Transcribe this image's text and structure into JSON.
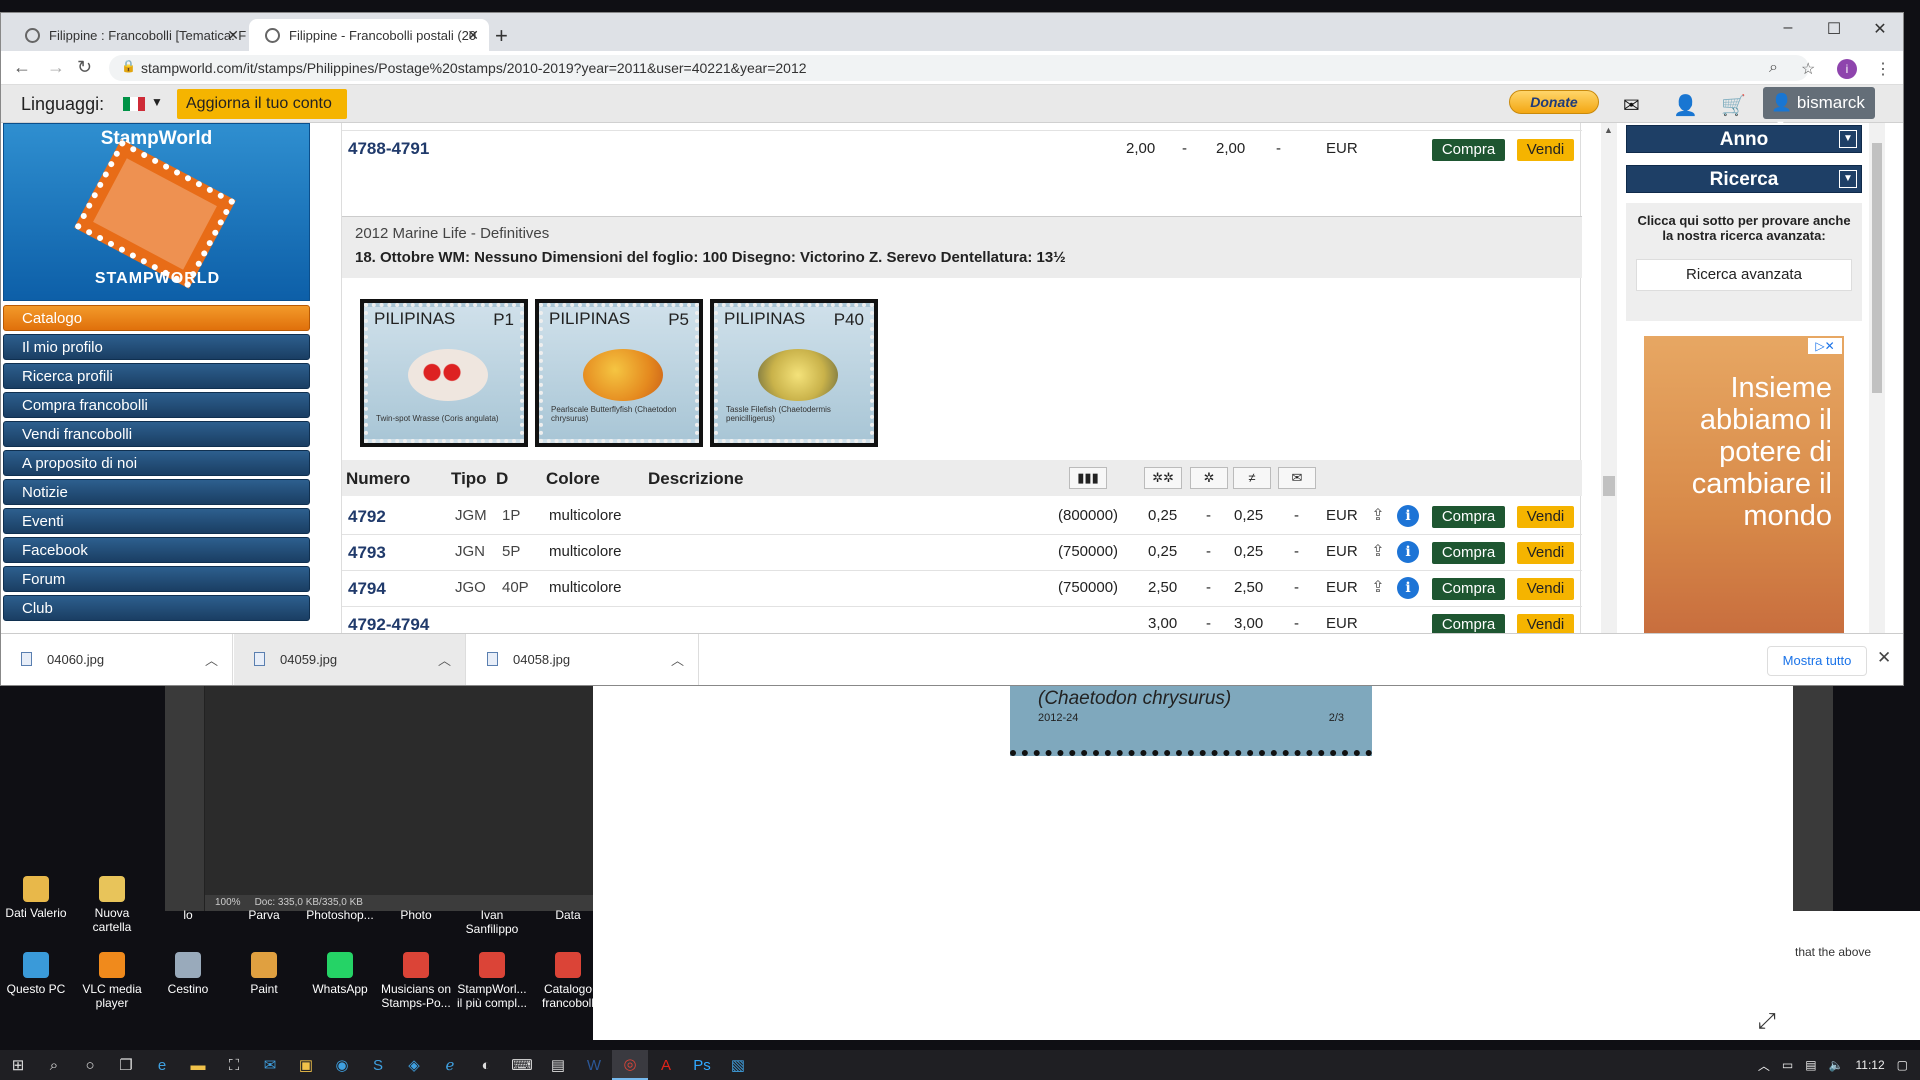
{
  "browser": {
    "tabs": [
      {
        "title": "Filippine : Francobolli [Tematica: F",
        "close": "✕"
      },
      {
        "title": "Filippine - Francobolli postali (20",
        "close": "✕"
      }
    ],
    "new_tab": "+",
    "window_controls": {
      "minimize": "–",
      "maximize": "☐",
      "close": "✕"
    },
    "url": "stampworld.com/it/stamps/Philippines/Postage%20stamps/2010-2019?year=2011&user=40221&year=2012",
    "avatar_letter": "i"
  },
  "topbar": {
    "languages_label": "Linguaggi:",
    "upgrade": "Aggiorna il tuo conto",
    "donate": "Donate",
    "user": "bismarck"
  },
  "sidebar": {
    "logo_title": "StampWorld",
    "logo_footer": "STAMPWORLD",
    "items": [
      {
        "label": "Catalogo",
        "active": true
      },
      {
        "label": "Il mio profilo"
      },
      {
        "label": "Ricerca profili"
      },
      {
        "label": "Compra francobolli"
      },
      {
        "label": "Vendi francobolli"
      },
      {
        "label": "A proposito di noi"
      },
      {
        "label": "Notizie"
      },
      {
        "label": "Eventi"
      },
      {
        "label": "Facebook"
      },
      {
        "label": "Forum"
      },
      {
        "label": "Club"
      }
    ]
  },
  "prev_total": {
    "number": "4788-4791",
    "unused": "2,00",
    "dash1": "-",
    "used": "2,00",
    "dash2": "-",
    "currency": "EUR",
    "buy": "Compra",
    "sell": "Vendi"
  },
  "set": {
    "title": "2012 Marine Life - Definitives",
    "description": "18. Ottobre WM: Nessuno Dimensioni del foglio: 100 Disegno: Victorino Z. Serevo Dentellatura: 13½",
    "images": [
      {
        "country": "PILIPINAS",
        "value": "P1",
        "caption": "Twin-spot Wrasse (Coris angulata)"
      },
      {
        "country": "PILIPINAS",
        "value": "P5",
        "caption": "Pearlscale Butterflyfish (Chaetodon chrysurus)"
      },
      {
        "country": "PILIPINAS",
        "value": "P40",
        "caption": "Tassle Filefish (Chaetodermis penicilligerus)"
      }
    ]
  },
  "table": {
    "headers": {
      "number": "Numero",
      "type": "Tipo",
      "d": "D",
      "color": "Colore",
      "description": "Descrizione"
    },
    "rows": [
      {
        "number": "4792",
        "type": "JGM",
        "d": "1P",
        "color": "multicolore",
        "qty": "(800000)",
        "unused": "0,25",
        "dash1": "-",
        "used": "0,25",
        "dash2": "-",
        "currency": "EUR",
        "buy": "Compra",
        "sell": "Vendi"
      },
      {
        "number": "4793",
        "type": "JGN",
        "d": "5P",
        "color": "multicolore",
        "qty": "(750000)",
        "unused": "0,25",
        "dash1": "-",
        "used": "0,25",
        "dash2": "-",
        "currency": "EUR",
        "buy": "Compra",
        "sell": "Vendi"
      },
      {
        "number": "4794",
        "type": "JGO",
        "d": "40P",
        "color": "multicolore",
        "qty": "(750000)",
        "unused": "2,50",
        "dash1": "-",
        "used": "2,50",
        "dash2": "-",
        "currency": "EUR",
        "buy": "Compra",
        "sell": "Vendi"
      }
    ],
    "total": {
      "number": "4792-4794",
      "unused": "3,00",
      "dash1": "-",
      "used": "3,00",
      "dash2": "-",
      "currency": "EUR",
      "buy": "Compra",
      "sell": "Vendi"
    }
  },
  "right_sidebar": {
    "anno": "Anno",
    "ricerca": "Ricerca",
    "search_hint": "Clicca qui sotto per provare anche la nostra ricerca avanzata:",
    "advanced": "Ricerca avanzata",
    "ad_text": "Insieme abbiamo il potere di cambiare il mondo"
  },
  "downloads": {
    "files": [
      "04060.jpg",
      "04059.jpg",
      "04058.jpg"
    ],
    "show_all": "Mostra tutto",
    "close": "✕"
  },
  "background": {
    "stamp_text_italic": "(Chaetodon chrysurus)",
    "stamp_year": "2012-24",
    "stamp_idx": "2/3",
    "ps_zoom": "100%",
    "ps_doc": "Doc: 335,0 KB/335,0 KB",
    "right_text": "that the above"
  },
  "desktop": {
    "icons": [
      {
        "label": "Dati Valerio",
        "color": "#e8b84a"
      },
      {
        "label": "Nuova cartella",
        "color": "#e8c45a"
      },
      {
        "label": "Questo PC",
        "color": "#3a9ad9"
      },
      {
        "label": "VLC media player",
        "color": "#f08a1c"
      },
      {
        "label": "Cestino",
        "color": "#9ab"
      },
      {
        "label": "Paint",
        "color": "#e0a040"
      },
      {
        "label": "WhatsApp",
        "color": "#25d366"
      },
      {
        "label": "Musicians on Stamps-Po...",
        "color": "#db4437"
      },
      {
        "label": "StampWorl... il più compl...",
        "color": "#db4437"
      },
      {
        "label": "Catalogo francoboll",
        "color": "#db4437"
      }
    ],
    "partial_labels": [
      "lo",
      "Parva",
      "Photoshop...",
      "Photo",
      "Ivan Sanfilippo",
      "Data"
    ]
  },
  "taskbar": {
    "time": "11:12"
  }
}
